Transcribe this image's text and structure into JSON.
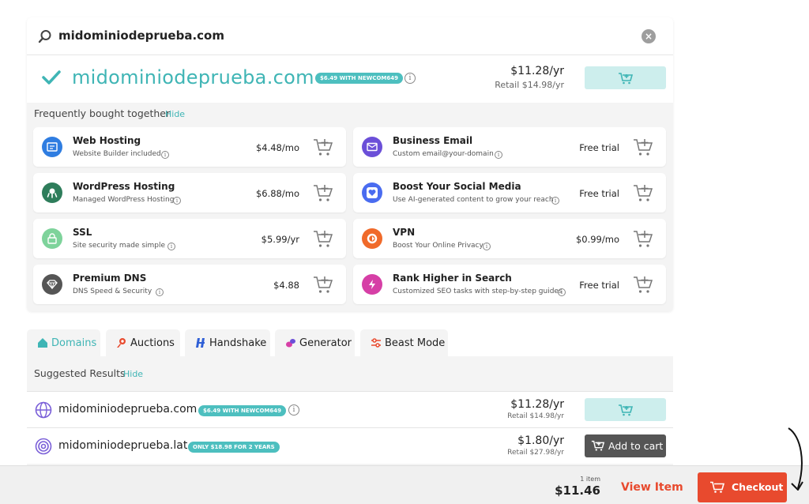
{
  "search": {
    "query": "midominiodeprueba.com",
    "clear_icon": "close-icon"
  },
  "main_result": {
    "domain": "midominiodeprueba.com",
    "promo": "$6.49 WITH NEWCOM649",
    "price": "$11.28/yr",
    "retail": "Retail $14.98/yr",
    "accent_color": "#3fb5b5"
  },
  "fbt": {
    "label": "Frequently bought together",
    "hide": "Hide"
  },
  "addons": [
    {
      "title": "Web Hosting",
      "subtitle": "Website Builder included",
      "price": "$4.48/mo",
      "icon": "web-hosting-icon",
      "color": "#2f7de1"
    },
    {
      "title": "Business Email",
      "subtitle": "Custom email@your-domain",
      "price": "Free trial",
      "icon": "email-icon",
      "color": "#6b4fd8"
    },
    {
      "title": "WordPress Hosting",
      "subtitle": "Managed WordPress Hosting",
      "price": "$6.88/mo",
      "icon": "wordpress-icon",
      "color": "#2e7d5b"
    },
    {
      "title": "Boost Your Social Media",
      "subtitle": "Use AI-generated content to grow your reach",
      "price": "Free trial",
      "icon": "social-heart-icon",
      "color": "#4a6cf0"
    },
    {
      "title": "SSL",
      "subtitle": "Site security made simple",
      "price": "$5.99/yr",
      "icon": "lock-icon",
      "color": "#7ed39b"
    },
    {
      "title": "VPN",
      "subtitle": "Boost Your Online Privacy",
      "price": "$0.99/mo",
      "icon": "vpn-icon",
      "color": "#f06a2a"
    },
    {
      "title": "Premium DNS",
      "subtitle": "DNS Speed & Security",
      "price": "$4.88",
      "icon": "diamond-icon",
      "color": "#555555"
    },
    {
      "title": "Rank Higher in Search",
      "subtitle": "Customized SEO tasks with step-by-step guides",
      "price": "Free trial",
      "icon": "seo-bolt-icon",
      "color": "#d63fa6"
    }
  ],
  "tabs": [
    {
      "label": "Domains",
      "icon": "home-icon"
    },
    {
      "label": "Auctions",
      "icon": "auction-icon"
    },
    {
      "label": "Handshake",
      "icon": "handshake-icon"
    },
    {
      "label": "Generator",
      "icon": "generator-icon"
    },
    {
      "label": "Beast Mode",
      "icon": "sliders-icon"
    }
  ],
  "suggested": {
    "label": "Suggested Results",
    "hide": "Hide",
    "rows": [
      {
        "domain": "midominiodeprueba.com",
        "promo": "$6.49 WITH NEWCOM649",
        "price": "$11.28/yr",
        "retail": "Retail $14.98/yr"
      },
      {
        "domain": "midominiodeprueba.lat",
        "promo": "ONLY $18.98 FOR 2 YEARS",
        "price": "$1.80/yr",
        "retail": "Retail $27.98/yr",
        "button": "Add to cart"
      }
    ]
  },
  "cart": {
    "count": "1 item",
    "total": "$11.46",
    "view_item": "View Item",
    "checkout": "Checkout",
    "accent_color": "#e84a2e"
  }
}
